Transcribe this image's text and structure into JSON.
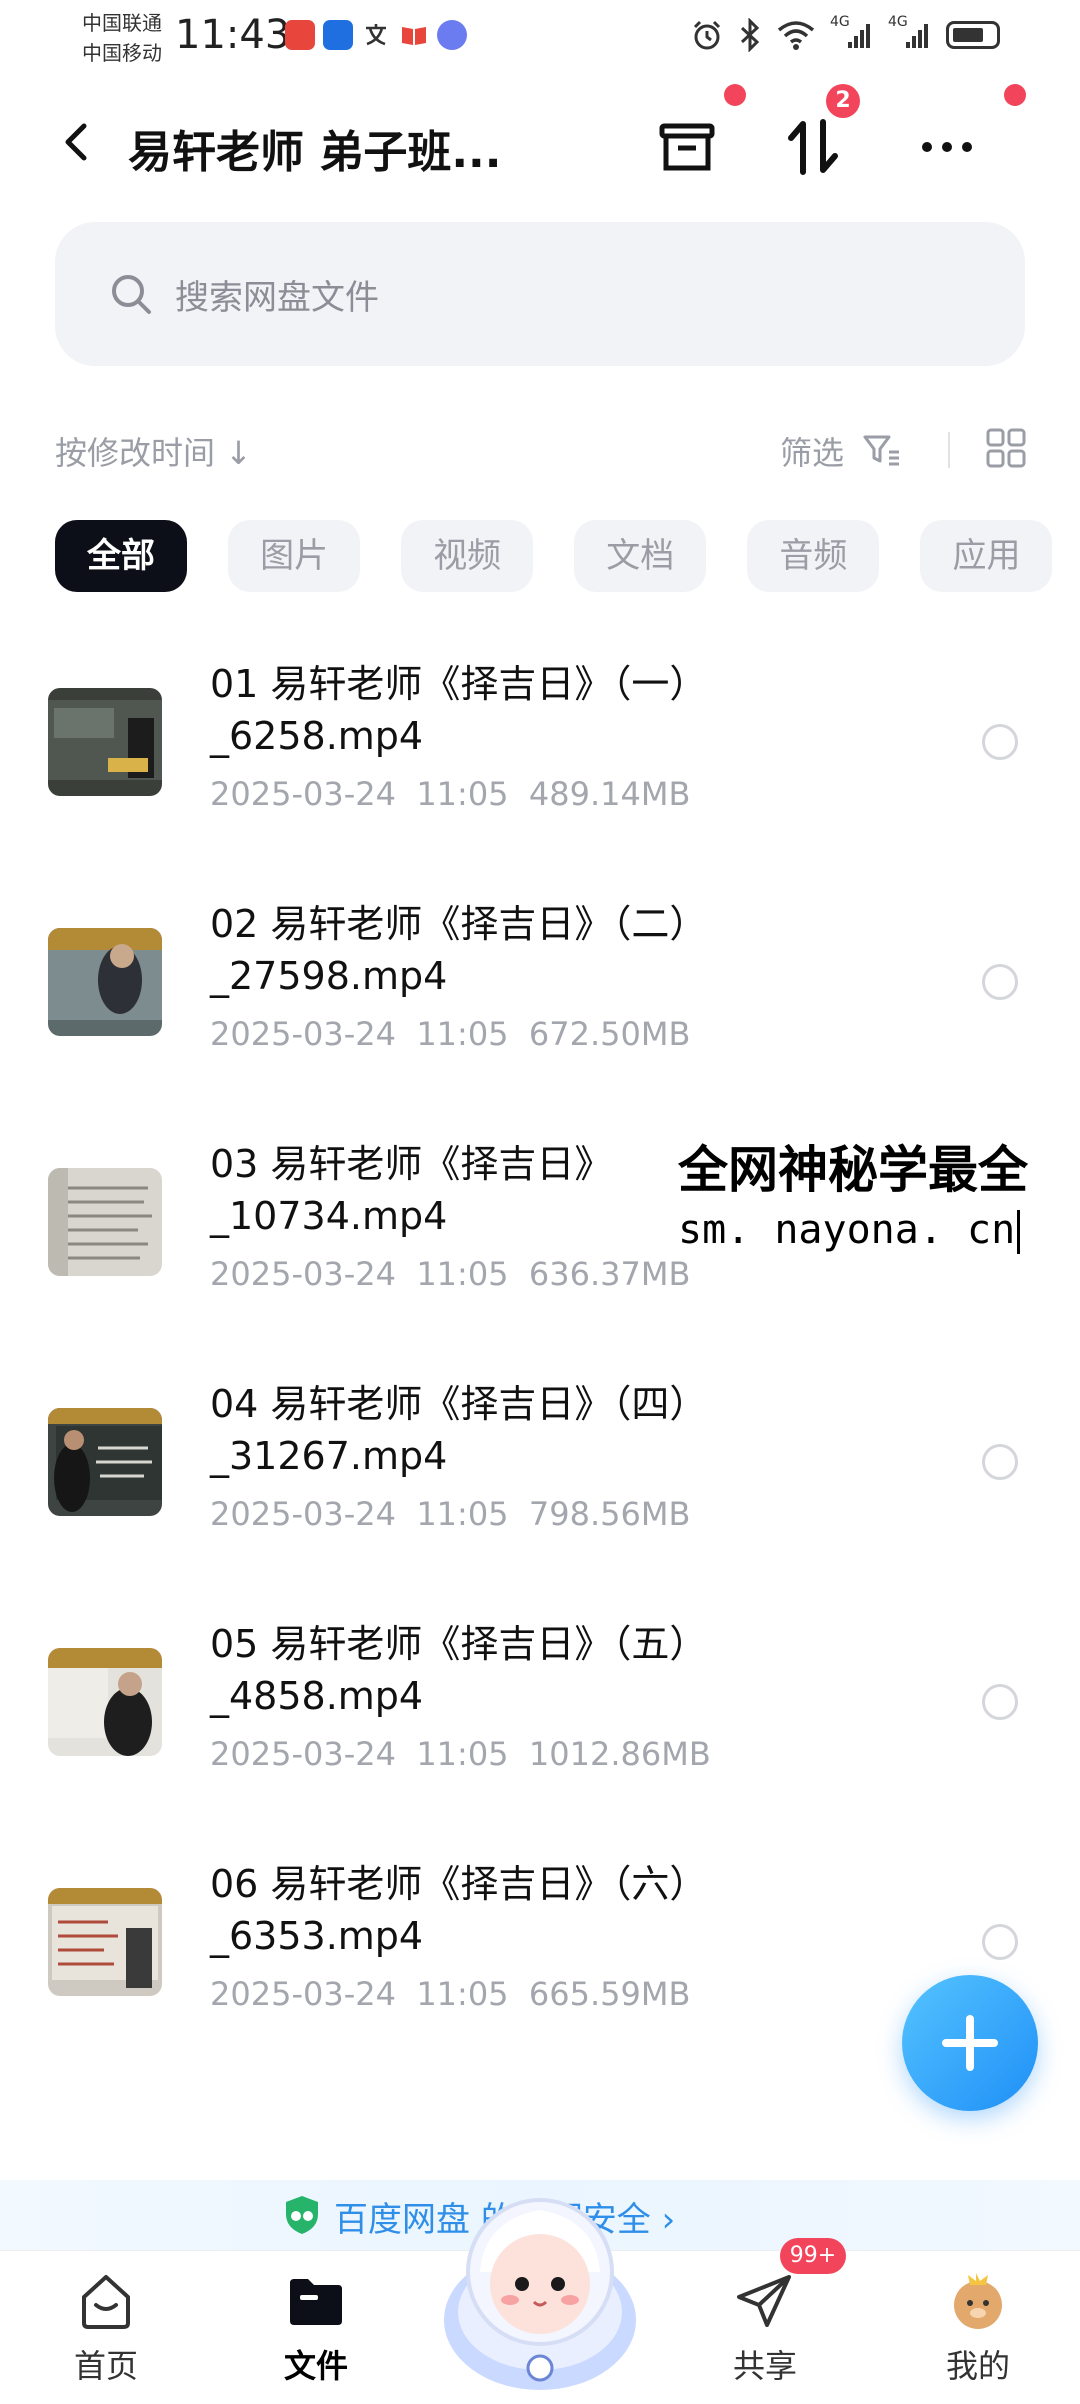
{
  "status_bar": {
    "carrier_1": "中国联通",
    "carrier_2": "中国移动",
    "time": "11:43",
    "network_1": "4G",
    "network_2": "4G"
  },
  "header": {
    "title": "易轩老师 弟子班..."
  },
  "toolbar": {
    "transfer_badge": "2"
  },
  "search": {
    "placeholder": "搜索网盘文件"
  },
  "sort": {
    "label": "按修改时间 ↓",
    "filter_label": "筛选"
  },
  "categories": [
    "全部",
    "图片",
    "视频",
    "文档",
    "音频",
    "应用"
  ],
  "active_category": "全部",
  "files": [
    {
      "name": "01 易轩老师《择吉日》（一）_6258.mp4",
      "date": "2025-03-24",
      "time": "11:05",
      "size": "489.14MB"
    },
    {
      "name": "02 易轩老师《择吉日》（二）_27598.mp4",
      "date": "2025-03-24",
      "time": "11:05",
      "size": "672.50MB"
    },
    {
      "name": "03 易轩老师《择吉日》_10734.mp4",
      "date": "2025-03-24",
      "time": "11:05",
      "size": "636.37MB"
    },
    {
      "name": "04 易轩老师《择吉日》（四）_31267.mp4",
      "date": "2025-03-24",
      "time": "11:05",
      "size": "798.56MB"
    },
    {
      "name": "05 易轩老师《择吉日》（五）_4858.mp4",
      "date": "2025-03-24",
      "time": "11:05",
      "size": "1012.86MB"
    },
    {
      "name": "06 易轩老师《择吉日》（六）_6353.mp4",
      "date": "2025-03-24",
      "time": "11:05",
      "size": "665.59MB"
    }
  ],
  "overlay": {
    "line1": "全网神秘学最全",
    "line2": "sm. nayona. cn"
  },
  "banner": {
    "text": "百度网盘 的数据安全 ›"
  },
  "bottom_nav": {
    "home": "首页",
    "files": "文件",
    "share": "共享",
    "share_badge": "99+",
    "mine": "我的"
  },
  "colors": {
    "accent": "#2f8fe8",
    "badge": "#f2445a",
    "active_chip": "#0c0f17"
  }
}
